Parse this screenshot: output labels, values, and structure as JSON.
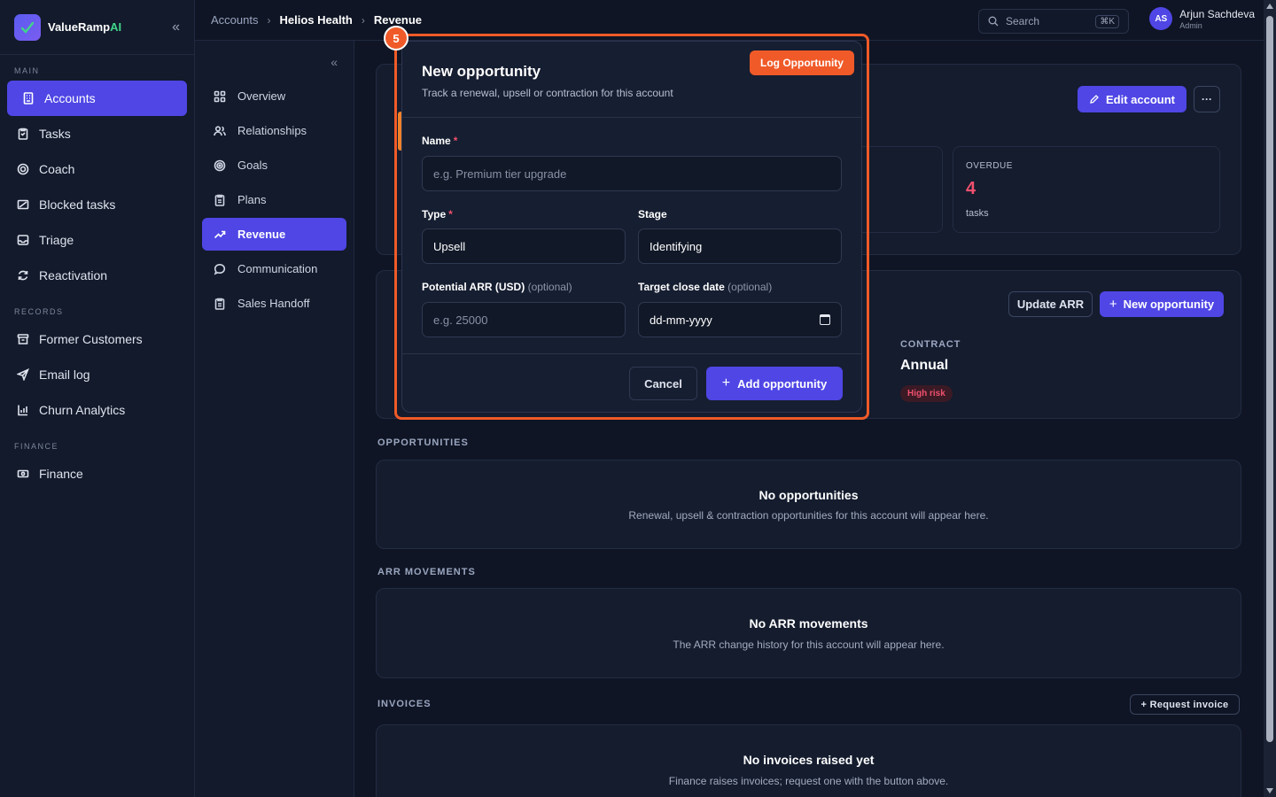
{
  "brand": {
    "name": "ValueRamp",
    "suffix": "AI"
  },
  "sidebar": {
    "sections": [
      {
        "label": "MAIN",
        "items": [
          {
            "label": "Accounts",
            "icon": "building-icon",
            "active": true
          },
          {
            "label": "Tasks",
            "icon": "clipboard-icon"
          },
          {
            "label": "Coach",
            "icon": "target-icon"
          },
          {
            "label": "Blocked tasks",
            "icon": "blocked-icon"
          },
          {
            "label": "Triage",
            "icon": "inbox-icon"
          },
          {
            "label": "Reactivation",
            "icon": "refresh-icon"
          }
        ]
      },
      {
        "label": "RECORDS",
        "items": [
          {
            "label": "Former Customers",
            "icon": "archive-icon"
          },
          {
            "label": "Email log",
            "icon": "send-icon"
          },
          {
            "label": "Churn Analytics",
            "icon": "chart-icon"
          }
        ]
      },
      {
        "label": "FINANCE",
        "items": [
          {
            "label": "Finance",
            "icon": "cash-icon"
          }
        ]
      }
    ]
  },
  "subnav": {
    "items": [
      {
        "label": "Overview",
        "icon": "grid-icon"
      },
      {
        "label": "Relationships",
        "icon": "users-icon"
      },
      {
        "label": "Goals",
        "icon": "target-icon"
      },
      {
        "label": "Plans",
        "icon": "clipboard-icon"
      },
      {
        "label": "Revenue",
        "icon": "trend-up-icon",
        "active": true
      },
      {
        "label": "Communication",
        "icon": "message-icon"
      },
      {
        "label": "Sales Handoff",
        "icon": "clipboard-icon"
      }
    ]
  },
  "breadcrumb": [
    "Accounts",
    "Helios Health",
    "Revenue"
  ],
  "search": {
    "placeholder": "Search",
    "shortcut": "⌘K"
  },
  "user": {
    "initials": "AS",
    "name": "Arjun Sachdeva",
    "role": "Admin"
  },
  "header_card": {
    "edit_label": "Edit account",
    "more_label": "···",
    "overdue": {
      "label": "OVERDUE",
      "value": "4",
      "unit": "tasks"
    }
  },
  "revenue_card": {
    "update_arr_label": "Update ARR",
    "new_opportunity_label": "New opportunity",
    "contract_label": "CONTRACT",
    "contract_value": "Annual",
    "risk_badge": "High risk"
  },
  "opportunities": {
    "title": "OPPORTUNITIES",
    "empty_title": "No opportunities",
    "empty_sub": "Renewal, upsell & contraction opportunities for this account will appear here."
  },
  "arr_movements": {
    "title": "ARR MOVEMENTS",
    "empty_title": "No ARR movements",
    "empty_sub": "The ARR change history for this account will appear here."
  },
  "invoices": {
    "title": "INVOICES",
    "request_label": "+ Request invoice",
    "empty_title": "No invoices raised yet",
    "empty_sub": "Finance raises invoices; request one with the button above."
  },
  "annotation": {
    "step": "5",
    "pill": "Log Opportunity"
  },
  "modal": {
    "title": "New opportunity",
    "subtitle": "Track a renewal, upsell or contraction for this account",
    "name_label": "Name",
    "name_placeholder": "e.g. Premium tier upgrade",
    "type_label": "Type",
    "type_value": "Upsell",
    "stage_label": "Stage",
    "stage_value": "Identifying",
    "arr_label": "Potential ARR (USD)",
    "arr_optional": "(optional)",
    "arr_placeholder": "e.g. 25000",
    "date_label": "Target close date",
    "date_optional": "(optional)",
    "date_placeholder": "dd-mm-yyyy",
    "required_mark": "*",
    "cancel_label": "Cancel",
    "add_label": "Add opportunity"
  },
  "colors": {
    "accent": "#4f46e5",
    "highlight": "#f05a28",
    "danger": "#f0506e",
    "brand_green": "#3fd68a"
  }
}
